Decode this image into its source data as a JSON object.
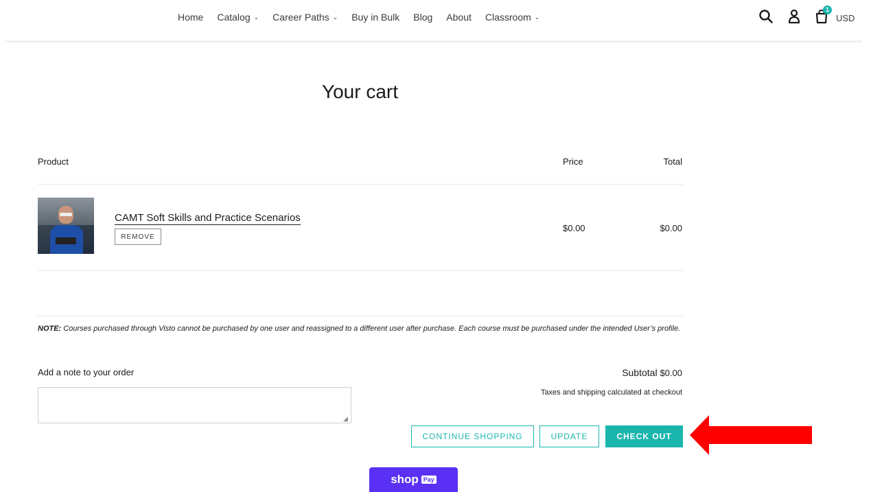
{
  "nav": {
    "items": [
      {
        "label": "Home",
        "dropdown": false
      },
      {
        "label": "Catalog",
        "dropdown": true
      },
      {
        "label": "Career Paths",
        "dropdown": true
      },
      {
        "label": "Buy in Bulk",
        "dropdown": false
      },
      {
        "label": "Blog",
        "dropdown": false
      },
      {
        "label": "About",
        "dropdown": false
      },
      {
        "label": "Classroom",
        "dropdown": true
      }
    ],
    "cart_count": "1",
    "currency": "USD",
    "icons": [
      "search-icon",
      "account-icon",
      "cart-icon",
      "chevron-down-icon"
    ]
  },
  "page": {
    "title": "Your cart"
  },
  "table": {
    "headers": {
      "product": "Product",
      "price": "Price",
      "total": "Total"
    },
    "items": [
      {
        "name": "CAMT Soft Skills and Practice Scenarios",
        "remove_label": "REMOVE",
        "price": "$0.00",
        "total": "$0.00"
      }
    ]
  },
  "note": {
    "bold": "NOTE:",
    "text": " Courses purchased through Visto cannot be purchased by one user and reassigned to a different user after purchase. Each course must be purchased under the intended User’s profile."
  },
  "order_note": {
    "label": "Add a note to your order",
    "value": "",
    "placeholder": ""
  },
  "summary": {
    "subtotal_label": "Subtotal",
    "subtotal_value": "$0.00",
    "tax_note": "Taxes and shipping calculated at checkout"
  },
  "buttons": {
    "continue": "CONTINUE SHOPPING",
    "update": "UPDATE",
    "checkout": "CHECK OUT"
  },
  "shop_pay": {
    "word": "shop",
    "badge": "Pay"
  },
  "colors": {
    "accent": "#1ab5ad",
    "shop_pay": "#5a31f4",
    "annotation_arrow": "#ff0000"
  }
}
